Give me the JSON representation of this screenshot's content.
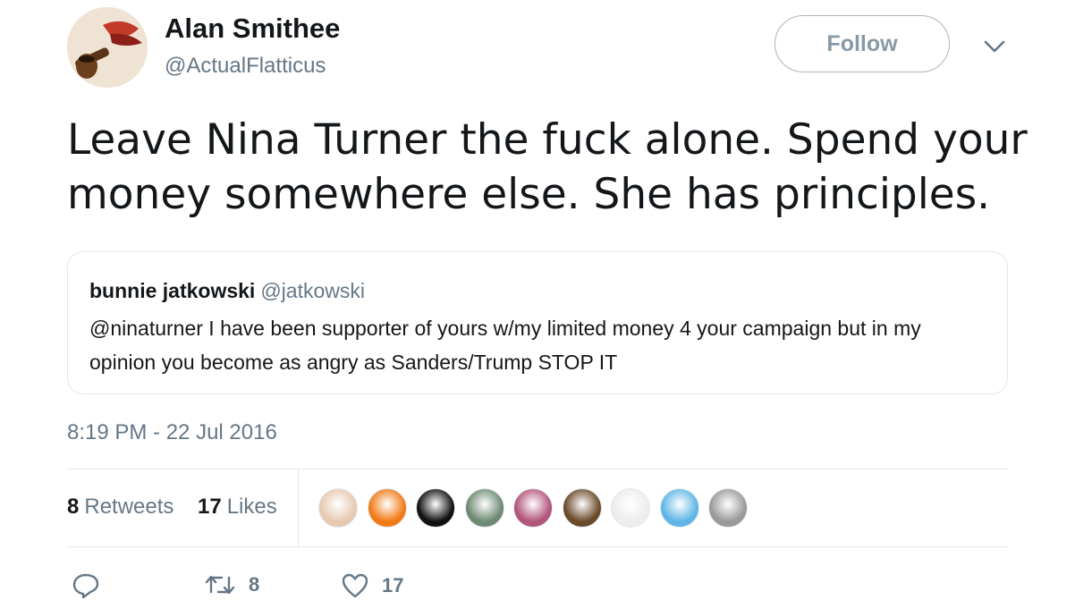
{
  "user": {
    "display_name": "Alan Smithee",
    "handle": "@ActualFlatticus"
  },
  "follow_label": "Follow",
  "tweet": {
    "text": "Leave Nina Turner the fuck alone.  Spend your money somewhere else.  She has principles.",
    "timestamp": "8:19 PM - 22 Jul 2016"
  },
  "quote": {
    "name": "bunnie jatkowski",
    "handle": "@jatkowski",
    "text": "@ninaturner I have been supporter of yours w/my limited money 4 your campaign but in my opinion you become as angry as Sanders/Trump STOP IT"
  },
  "stats": {
    "retweets_count": "8",
    "retweets_label": "Retweets",
    "likes_count": "17",
    "likes_label": "Likes"
  },
  "actions": {
    "reply_count": "",
    "retweet_count": "8",
    "like_count": "17"
  },
  "likers": [
    {
      "name": "liker-avatar-1",
      "color": "#e6c9b0"
    },
    {
      "name": "liker-avatar-2",
      "color": "#f27a16"
    },
    {
      "name": "liker-avatar-3",
      "color": "#111111"
    },
    {
      "name": "liker-avatar-4",
      "color": "#6e8a73"
    },
    {
      "name": "liker-avatar-5",
      "color": "#b2557a"
    },
    {
      "name": "liker-avatar-6",
      "color": "#6b4a2a"
    },
    {
      "name": "liker-avatar-7",
      "color": "#ededed"
    },
    {
      "name": "liker-avatar-8",
      "color": "#5fb6e6"
    },
    {
      "name": "liker-avatar-9",
      "color": "#9a9a9a"
    }
  ],
  "colors": {
    "secondary_text": "#657786",
    "border": "#e1e8ed",
    "follow_text": "#8899a6"
  }
}
